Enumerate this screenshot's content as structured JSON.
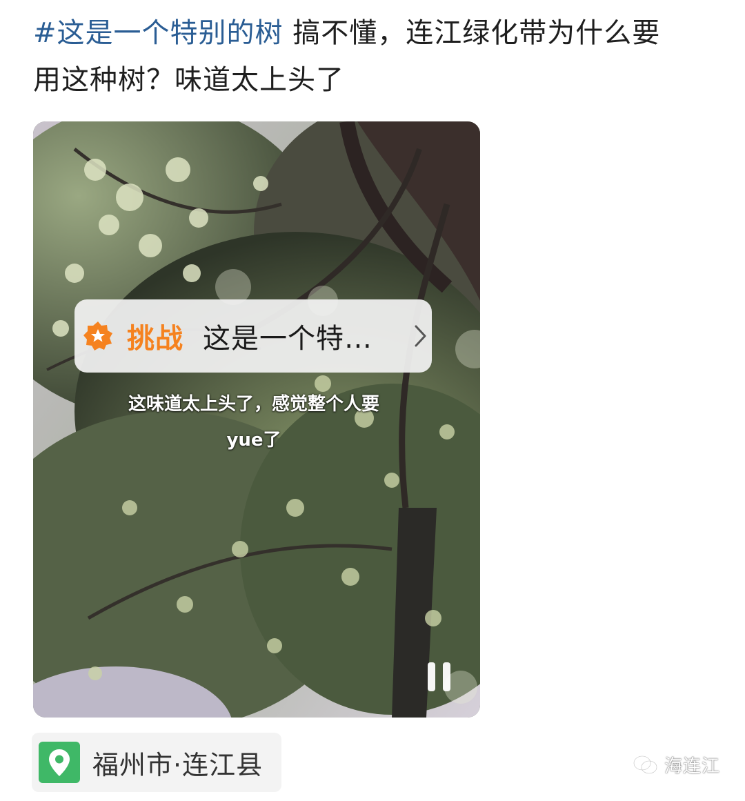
{
  "post": {
    "hashtag": "#这是一个特别的树",
    "text_line1": " 搞不懂，连江绿化带为什么要",
    "text_line2": "用这种树？味道太上头了"
  },
  "video": {
    "challenge_label": "挑战",
    "challenge_name": "这是一个特…",
    "caption_line1": "这味道太上头了，感觉整个人要",
    "caption_line2": "yue了"
  },
  "location": {
    "text": "福州市·连江县",
    "icon": "location-pin-icon",
    "color": "#3fb867"
  },
  "watermark": {
    "text": "海连江"
  },
  "colors": {
    "hashtag": "#2a5d94",
    "challenge_accent": "#f5821f"
  }
}
